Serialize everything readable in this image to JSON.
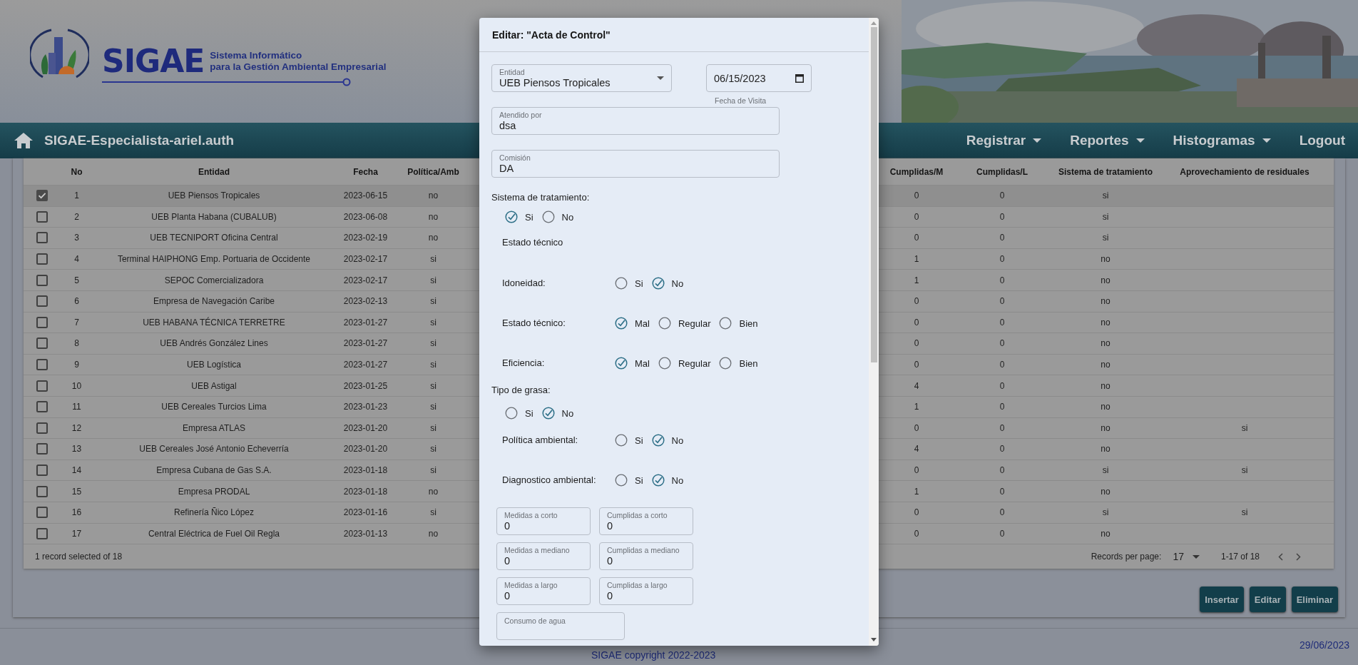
{
  "header": {
    "logo": {
      "word": "SIGAE",
      "tagline": [
        "Sistema Informático",
        "para la Gestión Ambiental Empresarial"
      ]
    }
  },
  "navbar": {
    "title": "SIGAE-Especialista-ariel.auth",
    "menus": [
      {
        "label": "Registrar",
        "kind": "dropdown"
      },
      {
        "label": "Reportes",
        "kind": "dropdown"
      },
      {
        "label": "Histogramas",
        "kind": "dropdown"
      },
      {
        "label": "Logout",
        "kind": "link"
      }
    ]
  },
  "table": {
    "columns": [
      "No",
      "Entidad",
      "Fecha",
      "Política/Amb",
      "Cumplidas/M",
      "Cumplidas/L",
      "Sistema de tratamiento",
      "Aprovechamiento de residuales"
    ],
    "rows": [
      {
        "selected": true,
        "cells": [
          "1",
          "UEB Piensos Tropicales",
          "2023-06-15",
          "no",
          "0",
          "0",
          "si"
        ]
      },
      {
        "selected": false,
        "cells": [
          "2",
          "UEB Planta Habana (CUBALUB)",
          "2023-06-08",
          "no",
          "0",
          "0",
          "si"
        ]
      },
      {
        "selected": false,
        "cells": [
          "3",
          "UEB TECNIPORT Oficina Central",
          "2023-02-19",
          "no",
          "0",
          "0",
          "si"
        ]
      },
      {
        "selected": false,
        "cells": [
          "4",
          "Terminal HAIPHONG Emp. Portuaria de Occidente",
          "2023-02-17",
          "si",
          "1",
          "0",
          "no"
        ]
      },
      {
        "selected": false,
        "cells": [
          "5",
          "SEPOC Comercializadora",
          "2023-02-17",
          "si",
          "1",
          "0",
          "no"
        ]
      },
      {
        "selected": false,
        "cells": [
          "6",
          "Empresa de Navegación Caribe",
          "2023-02-13",
          "si",
          "0",
          "0",
          "no"
        ]
      },
      {
        "selected": false,
        "cells": [
          "7",
          "UEB HABANA TÉCNICA TERRETRE",
          "2023-01-27",
          "si",
          "0",
          "0",
          "no"
        ]
      },
      {
        "selected": false,
        "cells": [
          "8",
          "UEB Andrés González Lines",
          "2023-01-27",
          "si",
          "0",
          "0",
          "no"
        ]
      },
      {
        "selected": false,
        "cells": [
          "9",
          "UEB Logística",
          "2023-01-27",
          "si",
          "0",
          "0",
          "no"
        ]
      },
      {
        "selected": false,
        "cells": [
          "10",
          "UEB Astigal",
          "2023-01-25",
          "si",
          "4",
          "0",
          "no"
        ]
      },
      {
        "selected": false,
        "cells": [
          "11",
          "UEB Cereales Turcios Lima",
          "2023-01-23",
          "si",
          "1",
          "0",
          "no"
        ]
      },
      {
        "selected": false,
        "cells": [
          "12",
          "Empresa ATLAS",
          "2023-01-20",
          "si",
          "0",
          "0",
          "no",
          "si"
        ]
      },
      {
        "selected": false,
        "cells": [
          "13",
          "UEB Cereales José Antonio Echeverría",
          "2023-01-20",
          "si",
          "4",
          "0",
          "no"
        ]
      },
      {
        "selected": false,
        "cells": [
          "14",
          "Empresa Cubana de Gas S.A.",
          "2023-01-18",
          "si",
          "0",
          "0",
          "si",
          "si"
        ]
      },
      {
        "selected": false,
        "cells": [
          "15",
          "Empresa PRODAL",
          "2023-01-18",
          "no",
          "1",
          "0",
          "no"
        ]
      },
      {
        "selected": false,
        "cells": [
          "16",
          "Refinería Ñico López",
          "2023-01-16",
          "si",
          "0",
          "0",
          "si",
          "si"
        ]
      },
      {
        "selected": false,
        "cells": [
          "17",
          "Central Eléctrica de Fuel Oil Regla",
          "2023-01-13",
          "no",
          "0",
          "0",
          "no"
        ]
      }
    ],
    "status": "1 record selected of 18",
    "pagination": {
      "label": "Records per page:",
      "per_page": "17",
      "range": "1-17 of 18"
    }
  },
  "actions": [
    "Insertar",
    "Editar",
    "Eliminar"
  ],
  "modal": {
    "title": "Editar: \"Acta de Control\"",
    "entidad": {
      "label": "Entidad",
      "value": "UEB Piensos Tropicales"
    },
    "fecha": {
      "value": "06/15/2023",
      "helper": "Fecha de Visita"
    },
    "atendido": {
      "label": "Atendido por",
      "value": "dsa"
    },
    "comision": {
      "label": "Comisión",
      "value": "DA"
    },
    "form": [
      {
        "kind": "heading",
        "text": "Sistema de tratamiento:"
      },
      {
        "kind": "radios",
        "options": [
          {
            "label": "Si",
            "checked": true
          },
          {
            "label": "No",
            "checked": false
          }
        ]
      },
      {
        "kind": "subheading",
        "text": "Estado técnico"
      },
      {
        "kind": "radio_row",
        "label": "Idoneidad:",
        "options": [
          {
            "label": "Si",
            "checked": false
          },
          {
            "label": "No",
            "checked": true
          }
        ]
      },
      {
        "kind": "radio_row",
        "label": "Estado técnico:",
        "options": [
          {
            "label": "Mal",
            "checked": true
          },
          {
            "label": "Regular",
            "checked": false
          },
          {
            "label": "Bien",
            "checked": false
          }
        ]
      },
      {
        "kind": "radio_row",
        "label": "Eficiencia:",
        "options": [
          {
            "label": "Mal",
            "checked": true
          },
          {
            "label": "Regular",
            "checked": false
          },
          {
            "label": "Bien",
            "checked": false
          }
        ]
      },
      {
        "kind": "heading",
        "text": "Tipo de grasa:"
      },
      {
        "kind": "radios",
        "options": [
          {
            "label": "Si",
            "checked": false
          },
          {
            "label": "No",
            "checked": true
          }
        ]
      },
      {
        "kind": "radio_row",
        "label": "Política ambiental:",
        "options": [
          {
            "label": "Si",
            "checked": false
          },
          {
            "label": "No",
            "checked": true
          }
        ]
      },
      {
        "kind": "radio_row",
        "label": "Diagnostico ambiental:",
        "options": [
          {
            "label": "Si",
            "checked": false
          },
          {
            "label": "No",
            "checked": true
          }
        ]
      }
    ],
    "measures": [
      {
        "label": "Medidas a corto",
        "value": "0"
      },
      {
        "label": "Cumplidas a corto",
        "value": "0"
      },
      {
        "label": "Medidas a mediano",
        "value": "0"
      },
      {
        "label": "Cumplidas a mediano",
        "value": "0"
      },
      {
        "label": "Medidas a largo",
        "value": "0"
      },
      {
        "label": "Cumplidas a largo",
        "value": "0"
      }
    ],
    "consumo": {
      "label": "Consumo de agua"
    }
  },
  "footer": {
    "copyright": "SIGAE copyright 2022-2023",
    "date": "29/06/2023"
  }
}
